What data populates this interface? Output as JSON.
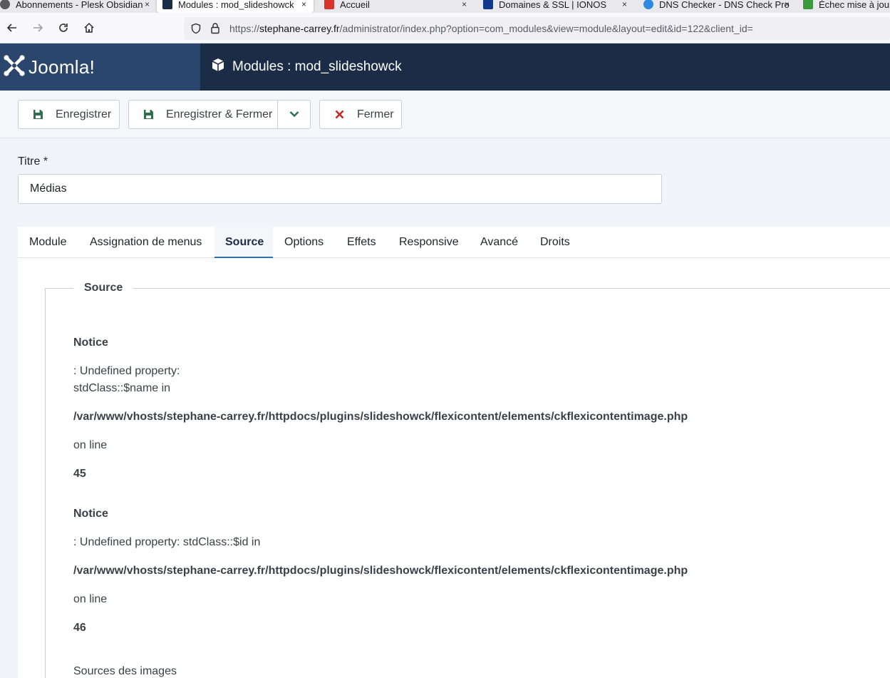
{
  "browser": {
    "tabs": [
      {
        "title": "Abonnements - Plesk Obsidian",
        "close": "×"
      },
      {
        "title": "Modules : mod_slideshowck",
        "close": "×"
      },
      {
        "title": "Accueil",
        "close": "×"
      },
      {
        "title": "Domaines & SSL | IONOS",
        "close": "×"
      },
      {
        "title": "DNS Checker - DNS Check Prop",
        "close": "×"
      },
      {
        "title": "Échec mise à jour J",
        "close": ""
      }
    ],
    "url_prefix": "https://",
    "url_host": "stephane-carrey.fr",
    "url_path": "/administrator/index.php?option=com_modules&view=module&layout=edit&id=122&client_id="
  },
  "header": {
    "logo_text": "Joomla!",
    "page_title": "Modules : mod_slideshowck"
  },
  "toolbar": {
    "save_label": "Enregistrer",
    "save_close_label": "Enregistrer & Fermer",
    "close_label": "Fermer"
  },
  "form": {
    "title_label": "Titre *",
    "title_value": "Médias"
  },
  "tabs": [
    "Module",
    "Assignation de menus",
    "Source",
    "Options",
    "Effets",
    "Responsive",
    "Avancé",
    "Droits"
  ],
  "active_tab": "Source",
  "source": {
    "legend": "Source",
    "notices": [
      {
        "heading": "Notice",
        "message_line1": ": Undefined property:",
        "message_line2": "stdClass::$name in",
        "path": "/var/www/vhosts/stephane-carrey.fr/httpdocs/plugins/slideshowck/flexicontent/elements/ckflexicontentimage.php",
        "on_line": "on line",
        "line": "45"
      },
      {
        "heading": "Notice",
        "message_line1": ": Undefined property: stdClass::$id in",
        "path": "/var/www/vhosts/stephane-carrey.fr/httpdocs/plugins/slideshowck/flexicontent/elements/ckflexicontentimage.php",
        "on_line": "on line",
        "line": "46"
      }
    ],
    "images_source_label": "Sources des images"
  },
  "colors": {
    "header_bg": "#1a2c46",
    "logo_bg": "#2a466d",
    "save_icon": "#2e6e4d",
    "close_icon": "#c52827",
    "active_tab_underline": "#3071a9"
  }
}
